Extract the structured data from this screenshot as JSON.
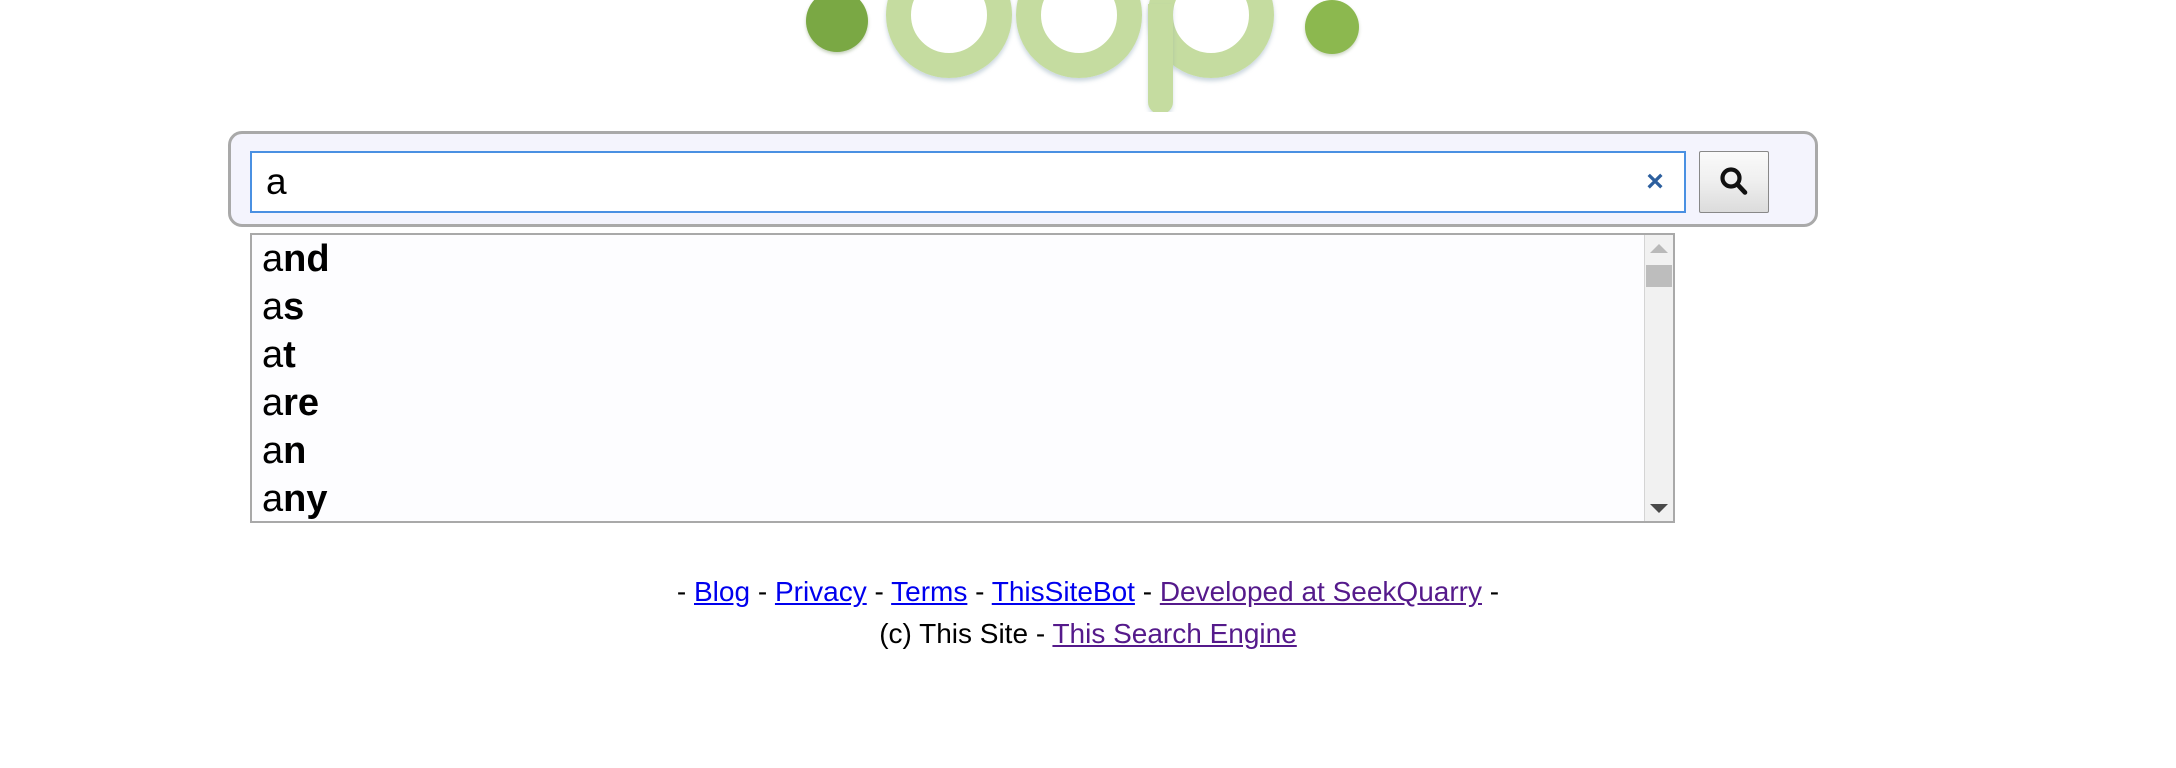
{
  "brand": {
    "name": "Yioop",
    "logo_icon": "yioop-logo-icon",
    "colors": {
      "dark_green": "#7aa844",
      "light_green": "#c5dca0",
      "accent_blue": "#4a90e2"
    }
  },
  "search": {
    "value": "a",
    "placeholder": "",
    "clear_label": "×",
    "clear_icon": "close-x-icon",
    "submit_icon": "magnifier-icon",
    "submit_label": "Search"
  },
  "suggestions": {
    "query_prefix": "a",
    "items": [
      {
        "prefix": "a",
        "rest": "nd",
        "full": "and"
      },
      {
        "prefix": "a",
        "rest": "s",
        "full": "as"
      },
      {
        "prefix": "a",
        "rest": "t",
        "full": "at"
      },
      {
        "prefix": "a",
        "rest": "re",
        "full": "are"
      },
      {
        "prefix": "a",
        "rest": "n",
        "full": "an"
      },
      {
        "prefix": "a",
        "rest": "ny",
        "full": "any"
      }
    ],
    "scrollbar": {
      "up_icon": "chevron-up-icon",
      "down_icon": "chevron-down-icon",
      "thumb_position_percent": 10
    }
  },
  "footer": {
    "line1_lead": "-",
    "line1_trail": "-",
    "links": [
      {
        "label": "Blog",
        "state": "unvisited"
      },
      {
        "label": "Privacy",
        "state": "unvisited"
      },
      {
        "label": "Terms",
        "state": "unvisited"
      },
      {
        "label": "ThisSiteBot",
        "state": "unvisited"
      },
      {
        "label": "Developed at SeekQuarry",
        "state": "visited"
      }
    ],
    "separator": "-",
    "copyright": "(c) This Site",
    "engine_link": {
      "label": "This Search Engine",
      "state": "visited"
    },
    "line2_separator": "-"
  }
}
